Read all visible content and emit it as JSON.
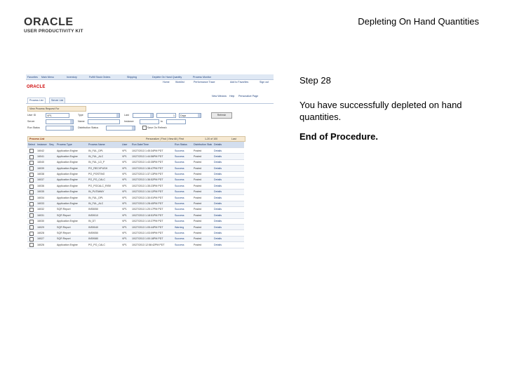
{
  "slide": {
    "logo_brand": "ORACLE",
    "logo_subtitle": "USER PRODUCTIVITY KIT",
    "title": "Depleting On Hand Quantities"
  },
  "step": {
    "number": "Step 28",
    "text": "You have successfully depleted on hand quantities.",
    "end": "End of Procedure."
  },
  "screenshot": {
    "menu": [
      "Favorites",
      "Main Menu",
      "Inventory",
      "Fulfill Stock Orders",
      "Shipping",
      "Deplete On Hand Quantity",
      "Process Monitor"
    ],
    "sub_links": [
      "Home",
      "Worklist",
      "Performance Trace",
      "Add to Favorites",
      "Sign out"
    ],
    "brand": "ORACLE",
    "top_right_links": [
      "New Window",
      "Help",
      "Personalize Page"
    ],
    "tabs": [
      "Process List",
      "Server List"
    ],
    "criteria_header": "View Process Request For",
    "criteria": {
      "user_id_label": "User ID",
      "user_id_value": "VP1",
      "type_label": "Type",
      "last_label": "Last",
      "last_value": "1",
      "last_unit": "Days",
      "server_label": "Server",
      "name_label": "Name",
      "instance_label": "Instance",
      "to_label": "to",
      "run_status_label": "Run Status",
      "dist_status_label": "Distribution Status",
      "save_on_refresh_label": "Save On Refresh",
      "refresh_button": "Refresh"
    },
    "list_header": {
      "title": "Process List",
      "controls": "Personalize | Find | View All | First",
      "range": "1-20 of 100",
      "last": "Last"
    },
    "columns": [
      "Select",
      "Instance",
      "Seq.",
      "Process Type",
      "Process Name",
      "User",
      "Run Date/Time",
      "Run Status",
      "Distribution Status",
      "Details"
    ],
    "rows": [
      {
        "instance": "16042",
        "type": "Application Engine",
        "name": "IN_FUL_DPL",
        "user": "VP1",
        "datetime": "10/27/2013 1:45:34PM PDT",
        "status": "Success",
        "dist": "Posted",
        "details": "Details"
      },
      {
        "instance": "16041",
        "type": "Application Engine",
        "name": "IN_FUL_ALC",
        "user": "VP1",
        "datetime": "10/27/2013 1:44:56PM PDT",
        "status": "Success",
        "dist": "Posted",
        "details": "Details"
      },
      {
        "instance": "16040",
        "type": "Application Engine",
        "name": "IN_FUL_LD_P",
        "user": "VP1",
        "datetime": "10/27/2013 1:43:35PM PDT",
        "status": "Success",
        "dist": "Posted",
        "details": "Details"
      },
      {
        "instance": "16039",
        "type": "Application Engine",
        "name": "PO_RECVPUSH",
        "user": "VP1",
        "datetime": "10/27/2013 1:38:47PM PDT",
        "status": "Success",
        "dist": "Posted",
        "details": "Details"
      },
      {
        "instance": "16038",
        "type": "Application Engine",
        "name": "PO_POSTING",
        "user": "VP1",
        "datetime": "10/27/2013 1:37:13PM PDT",
        "status": "Success",
        "dist": "Posted",
        "details": "Details"
      },
      {
        "instance": "16037",
        "type": "Application Engine",
        "name": "PO_PO_CALC",
        "user": "VP1",
        "datetime": "10/27/2013 1:36:52PM PDT",
        "status": "Success",
        "dist": "Posted",
        "details": "Details"
      },
      {
        "instance": "16036",
        "type": "Application Engine",
        "name": "PO_POCALC_RISK",
        "user": "VP1",
        "datetime": "10/27/2013 1:35:23PM PDT",
        "status": "Success",
        "dist": "Posted",
        "details": "Details"
      },
      {
        "instance": "16035",
        "type": "Application Engine",
        "name": "IN_PUTAWAY",
        "user": "VP1",
        "datetime": "10/27/2013 1:34:12PM PDT",
        "status": "Success",
        "dist": "Posted",
        "details": "Details"
      },
      {
        "instance": "16034",
        "type": "Application Engine",
        "name": "IN_FUL_DPL",
        "user": "VP1",
        "datetime": "10/27/2013 1:30:01PM PDT",
        "status": "Success",
        "dist": "Posted",
        "details": "Details"
      },
      {
        "instance": "16033",
        "type": "Application Engine",
        "name": "IN_FUL_ALC",
        "user": "VP1",
        "datetime": "10/27/2013 1:28:40PM PDT",
        "status": "Success",
        "dist": "Posted",
        "details": "Details"
      },
      {
        "instance": "16032",
        "type": "SQR Report",
        "name": "INS5050",
        "user": "VP1",
        "datetime": "10/27/2013 1:20:17PM PDT",
        "status": "Success",
        "dist": "Posted",
        "details": "Details"
      },
      {
        "instance": "16031",
        "type": "SQR Report",
        "name": "INS9010",
        "user": "VP1",
        "datetime": "10/27/2013 1:18:51PM PDT",
        "status": "Success",
        "dist": "Posted",
        "details": "Details"
      },
      {
        "instance": "16030",
        "type": "Application Engine",
        "name": "IN_DT",
        "user": "VP1",
        "datetime": "10/27/2013 1:10:27PM PDT",
        "status": "Success",
        "dist": "Posted",
        "details": "Details"
      },
      {
        "instance": "16029",
        "type": "SQR Report",
        "name": "INS9040",
        "user": "VP1",
        "datetime": "10/27/2013 1:05:44PM PDT",
        "status": "Warning",
        "dist": "Posted",
        "details": "Details"
      },
      {
        "instance": "16028",
        "type": "SQR Report",
        "name": "INS9050",
        "user": "VP1",
        "datetime": "10/27/2013 1:03:09PM PDT",
        "status": "Success",
        "dist": "Posted",
        "details": "Details"
      },
      {
        "instance": "16027",
        "type": "SQR Report",
        "name": "INS9080",
        "user": "VP1",
        "datetime": "10/27/2013 1:00:18PM PDT",
        "status": "Success",
        "dist": "Posted",
        "details": "Details"
      },
      {
        "instance": "16026",
        "type": "Application Engine",
        "name": "PO_PO_CALC",
        "user": "VP1",
        "datetime": "10/27/2013 12:58:42PM PDT",
        "status": "Success",
        "dist": "Posted",
        "details": "Details"
      },
      {
        "instance": "16025",
        "type": "Application Engine",
        "name": "PO_POSTING",
        "user": "VP1",
        "datetime": "10/27/2013 12:55:30PM PDT",
        "status": "Success",
        "dist": "Posted",
        "details": "Details"
      },
      {
        "instance": "16024",
        "type": "Application Engine",
        "name": "IN_FUL_DPL",
        "user": "VP1",
        "datetime": "10/27/2013 12:51:16PM PDT",
        "status": "Success",
        "dist": "Posted",
        "details": "Details"
      },
      {
        "instance": "16023",
        "type": "COBOL SQL",
        "name": "PSPESTAB",
        "user": "VP1",
        "datetime": "10/27/2013 12:48:05PM PDT",
        "status": "Error",
        "dist": "N/A",
        "details": "Details"
      }
    ]
  }
}
